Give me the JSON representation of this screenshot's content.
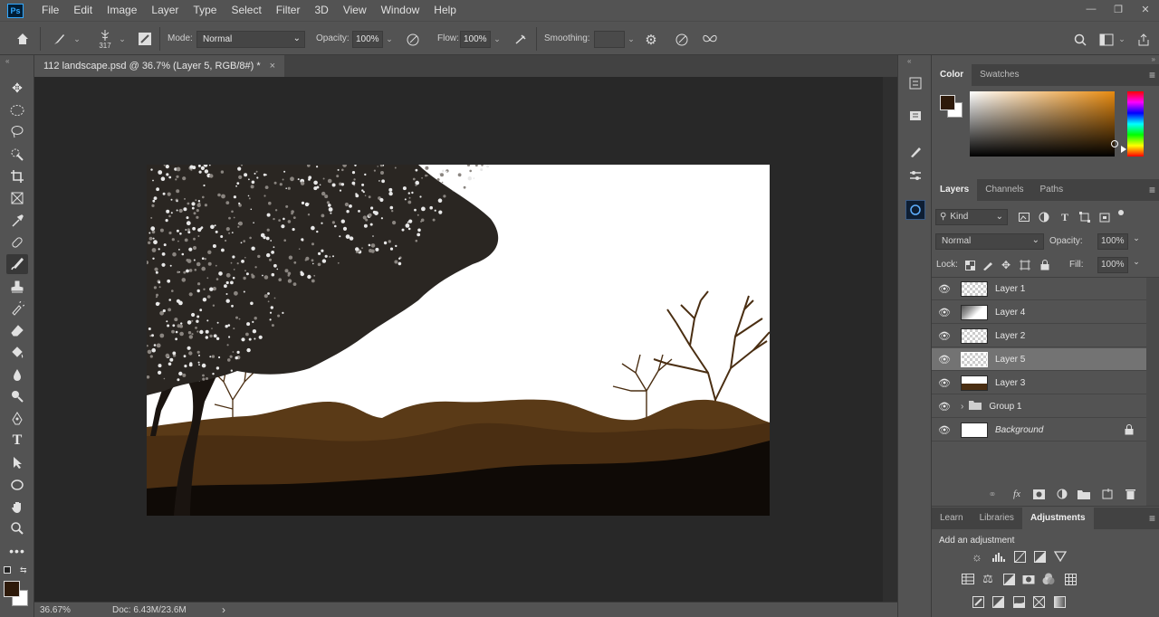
{
  "app": {
    "logo": "Ps"
  },
  "menu": [
    "File",
    "Edit",
    "Image",
    "Layer",
    "Type",
    "Select",
    "Filter",
    "3D",
    "View",
    "Window",
    "Help"
  ],
  "window_controls": {
    "minimize": "—",
    "restore": "❐",
    "close": "✕"
  },
  "options": {
    "brush_size": "317",
    "mode_label": "Mode:",
    "mode_value": "Normal",
    "opacity_label": "Opacity:",
    "opacity_value": "100%",
    "flow_label": "Flow:",
    "flow_value": "100%",
    "smoothing_label": "Smoothing:",
    "smoothing_value": ""
  },
  "document": {
    "tab_title": "112 landscape.psd @ 36.7% (Layer 5, RGB/8#) *",
    "tab_close": "×"
  },
  "status": {
    "zoom": "36.67%",
    "doc": "Doc: 6.43M/23.6M",
    "arrow": "›"
  },
  "color_panel": {
    "tabs": [
      "Color",
      "Swatches"
    ],
    "foreground": "#2e1a0a",
    "background": "#ffffff"
  },
  "layers_panel": {
    "tabs": [
      "Layers",
      "Channels",
      "Paths"
    ],
    "filter_value": "Kind",
    "blend_mode": "Normal",
    "opacity_label": "Opacity:",
    "opacity_value": "100%",
    "lock_label": "Lock:",
    "fill_label": "Fill:",
    "fill_value": "100%",
    "layers": [
      {
        "name": "Layer 1"
      },
      {
        "name": "Layer 4"
      },
      {
        "name": "Layer 2"
      },
      {
        "name": "Layer 5"
      },
      {
        "name": "Layer 3"
      },
      {
        "name": "Group 1"
      },
      {
        "name": "Background"
      }
    ]
  },
  "adjustments_panel": {
    "tabs": [
      "Learn",
      "Libraries",
      "Adjustments"
    ],
    "heading": "Add an adjustment"
  },
  "colors": {
    "accent": "#31a8ff",
    "ground_dark": "#0f0a06",
    "ground_mid": "#4a2e12",
    "hills": "#5a3a17",
    "tree": "#1a1410"
  }
}
